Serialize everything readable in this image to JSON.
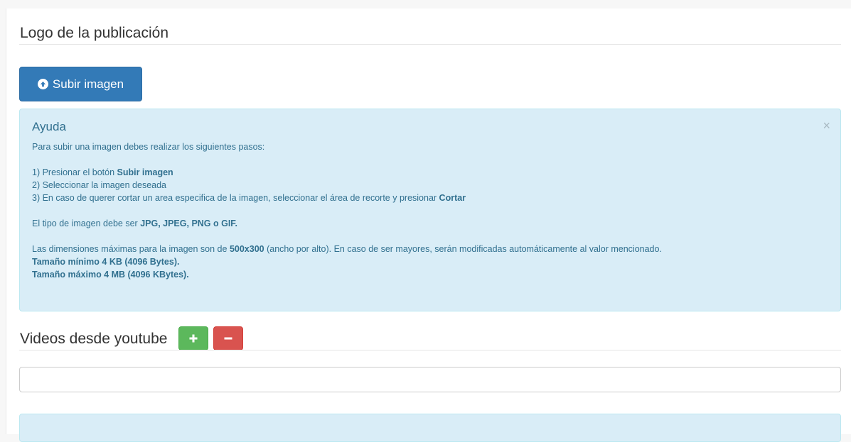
{
  "logo_section": {
    "title": "Logo de la publicación",
    "upload_button_label": "Subir imagen",
    "upload_icon": "circle-arrow-up-icon"
  },
  "help_alert": {
    "title": "Ayuda",
    "close_glyph": "×",
    "intro": "Para subir una imagen debes realizar los siguientes pasos:",
    "step1_text": "1) Presionar el botón ",
    "step1_bold": "Subir imagen",
    "step2_text": "2) Seleccionar la imagen deseada",
    "step3_text": "3) En caso de querer cortar un area especifica de la imagen, seleccionar el área de recorte y presionar ",
    "step3_bold": "Cortar",
    "type_text": "El tipo de imagen debe ser ",
    "type_bold": "JPG, JPEG, PNG o GIF.",
    "dims_text_before": "Las dimensiones máximas para la imagen son de ",
    "dims_bold": "500x300",
    "dims_text_after": " (ancho por alto). En caso de ser mayores, serán modificadas automáticamente al valor mencionado.",
    "min_size": "Tamaño mínimo 4 KB (4096 Bytes).",
    "max_size": "Tamaño máximo 4 MB (4096 KBytes)."
  },
  "videos_section": {
    "title": "Videos desde youtube",
    "add_icon": "plus-icon",
    "remove_icon": "minus-icon",
    "input_value": "",
    "input_placeholder": ""
  },
  "colors": {
    "primary": "#337ab7",
    "success": "#5cb85c",
    "danger": "#d9534f",
    "info_bg": "#d9edf7",
    "info_text": "#31708f"
  }
}
